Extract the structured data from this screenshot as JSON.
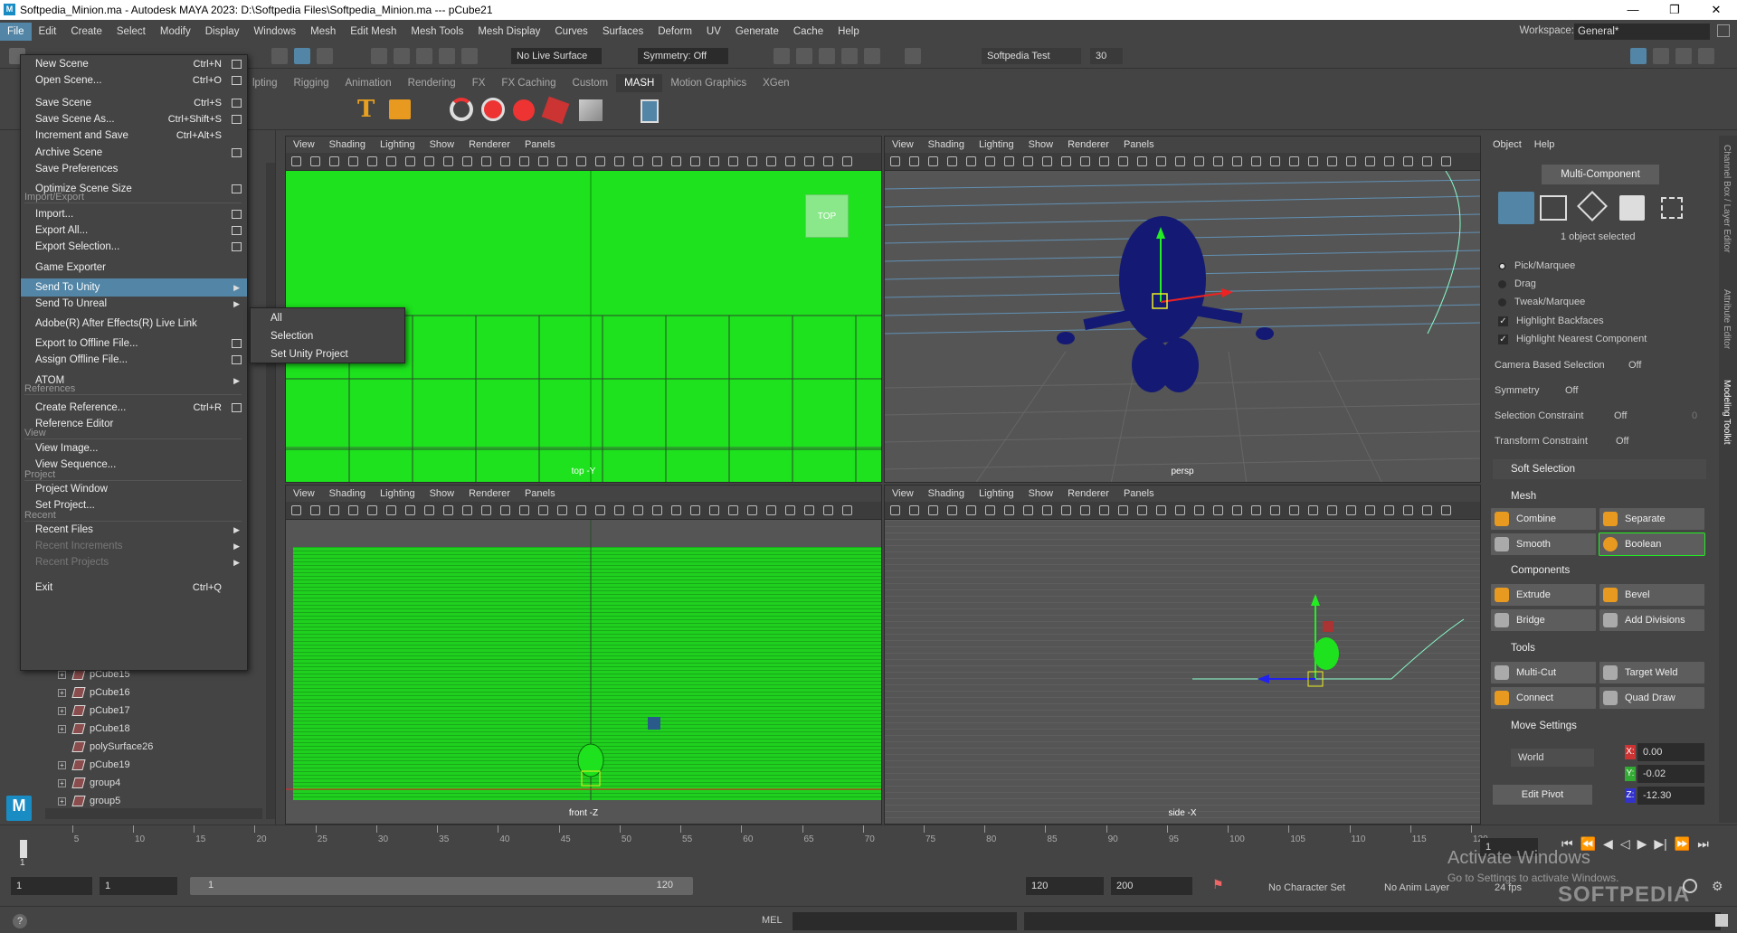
{
  "title_bar": {
    "title": "Softpedia_Minion.ma - Autodesk MAYA 2023: D:\\Softpedia Files\\Softpedia_Minion.ma  ---  pCube21",
    "minimize": "—",
    "maximize": "❐",
    "close": "✕"
  },
  "menubar": [
    "File",
    "Edit",
    "Create",
    "Select",
    "Modify",
    "Display",
    "Windows",
    "Mesh",
    "Edit Mesh",
    "Mesh Tools",
    "Mesh Display",
    "Curves",
    "Surfaces",
    "Deform",
    "UV",
    "Generate",
    "Cache",
    "Help"
  ],
  "workspace": {
    "label": "Workspace:",
    "value": "General*"
  },
  "status_line": {
    "live_surface": "No Live Surface",
    "symmetry": "Symmetry: Off",
    "user": "Softpedia Test",
    "count": "30"
  },
  "shelf_tabs": [
    "lpting",
    "Rigging",
    "Animation",
    "Rendering",
    "FX",
    "FX Caching",
    "Custom",
    "MASH",
    "Motion Graphics",
    "XGen"
  ],
  "shelf_active": "MASH",
  "viewport_menu": [
    "View",
    "Shading",
    "Lighting",
    "Show",
    "Renderer",
    "Panels"
  ],
  "viewports": {
    "top": "top -Y",
    "top_cube": "TOP",
    "persp": "persp",
    "front": "front -Z",
    "side": "side -X"
  },
  "file_menu": {
    "items": [
      {
        "label": "New Scene",
        "shortcut": "Ctrl+N",
        "box": true
      },
      {
        "label": "Open Scene...",
        "shortcut": "Ctrl+O",
        "box": true
      },
      {
        "label": "Save Scene",
        "shortcut": "Ctrl+S",
        "box": true
      },
      {
        "label": "Save Scene As...",
        "shortcut": "Ctrl+Shift+S",
        "box": true
      },
      {
        "label": "Increment and Save",
        "shortcut": "Ctrl+Alt+S",
        "box": false
      },
      {
        "label": "Archive Scene",
        "shortcut": "",
        "box": true
      },
      {
        "label": "Save Preferences",
        "shortcut": "",
        "box": false
      },
      {
        "label": "Optimize Scene Size",
        "shortcut": "",
        "box": true
      },
      {
        "label": "Import...",
        "shortcut": "",
        "box": true
      },
      {
        "label": "Export All...",
        "shortcut": "",
        "box": true
      },
      {
        "label": "Export Selection...",
        "shortcut": "",
        "box": true
      },
      {
        "label": "Game Exporter",
        "shortcut": "",
        "box": false
      },
      {
        "label": "Send To Unity",
        "shortcut": "",
        "arrow": true
      },
      {
        "label": "Send To Unreal",
        "shortcut": "",
        "arrow": true
      },
      {
        "label": "Adobe(R) After Effects(R) Live Link",
        "shortcut": "",
        "box": false
      },
      {
        "label": "Export to Offline File...",
        "shortcut": "",
        "box": true
      },
      {
        "label": "Assign Offline File...",
        "shortcut": "",
        "box": true
      },
      {
        "label": "ATOM",
        "shortcut": "",
        "arrow": true
      },
      {
        "label": "Create Reference...",
        "shortcut": "Ctrl+R",
        "box": true
      },
      {
        "label": "Reference Editor",
        "shortcut": "",
        "box": false
      },
      {
        "label": "View Image...",
        "shortcut": "",
        "box": false
      },
      {
        "label": "View Sequence...",
        "shortcut": "",
        "box": false
      },
      {
        "label": "Project Window",
        "shortcut": "",
        "box": false
      },
      {
        "label": "Set Project...",
        "shortcut": "",
        "box": false
      },
      {
        "label": "Recent Files",
        "shortcut": "",
        "arrow": true
      },
      {
        "label": "Recent Increments",
        "shortcut": "",
        "arrow": true
      },
      {
        "label": "Recent Projects",
        "shortcut": "",
        "arrow": true
      },
      {
        "label": "Exit",
        "shortcut": "Ctrl+Q",
        "box": false
      }
    ],
    "sections": [
      "Import/Export",
      "References",
      "View",
      "Project",
      "Recent"
    ]
  },
  "send_to_unity_submenu": [
    "All",
    "Selection",
    "Set Unity Project"
  ],
  "outliner": [
    "pCube15",
    "pCube16",
    "pCube17",
    "pCube18",
    "polySurface26",
    "pCube19",
    "group4",
    "group5"
  ],
  "modeling_toolkit": {
    "menu": [
      "Object",
      "Help"
    ],
    "mode": "Multi-Component",
    "selected": "1 object selected",
    "options": [
      "Pick/Marquee",
      "Drag",
      "Tweak/Marquee"
    ],
    "checks": [
      "Highlight Backfaces",
      "Highlight Nearest Component"
    ],
    "camera_based": {
      "label": "Camera Based Selection",
      "value": "Off"
    },
    "symmetry": {
      "label": "Symmetry",
      "value": "Off"
    },
    "selection_constraint": {
      "label": "Selection Constraint",
      "value": "Off",
      "num": "0"
    },
    "transform_constraint": {
      "label": "Transform Constraint",
      "value": "Off"
    },
    "soft_selection": "Soft Selection",
    "mesh": {
      "title": "Mesh",
      "buttons": [
        "Combine",
        "Separate",
        "Smooth",
        "Boolean"
      ]
    },
    "components": {
      "title": "Components",
      "buttons": [
        "Extrude",
        "Bevel",
        "Bridge",
        "Add Divisions"
      ]
    },
    "tools": {
      "title": "Tools",
      "buttons": [
        "Multi-Cut",
        "Target Weld",
        "Connect",
        "Quad Draw"
      ]
    },
    "move_settings": {
      "title": "Move Settings",
      "space": "World",
      "x": "0.00",
      "y": "-0.02",
      "z": "-12.30",
      "pivot": "Edit Pivot"
    }
  },
  "side_tabs": [
    "Channel Box / Layer Editor",
    "Attribute Editor",
    "Modeling Toolkit"
  ],
  "timeline": {
    "ticks": [
      "5",
      "10",
      "15",
      "20",
      "25",
      "30",
      "35",
      "40",
      "45",
      "50",
      "55",
      "60",
      "65",
      "70",
      "75",
      "80",
      "85",
      "90",
      "95",
      "100",
      "105",
      "110",
      "115",
      "120"
    ],
    "current": "1",
    "frame_field": "1"
  },
  "range": {
    "start": "1",
    "start2": "1",
    "slider_start": "1",
    "slider_end": "120",
    "end": "120",
    "end2": "200",
    "character": "No Character Set",
    "anim_layer": "No Anim Layer",
    "fps": "24 fps"
  },
  "command": {
    "lang": "MEL"
  },
  "watermark": {
    "activate": "Activate Windows",
    "activate_sub": "Go to Settings to activate Windows.",
    "softpedia": "SOFTPEDIA"
  },
  "colors": {
    "accent": "#5285a6",
    "green_view": "#1de21d",
    "minion": "#141a73"
  }
}
